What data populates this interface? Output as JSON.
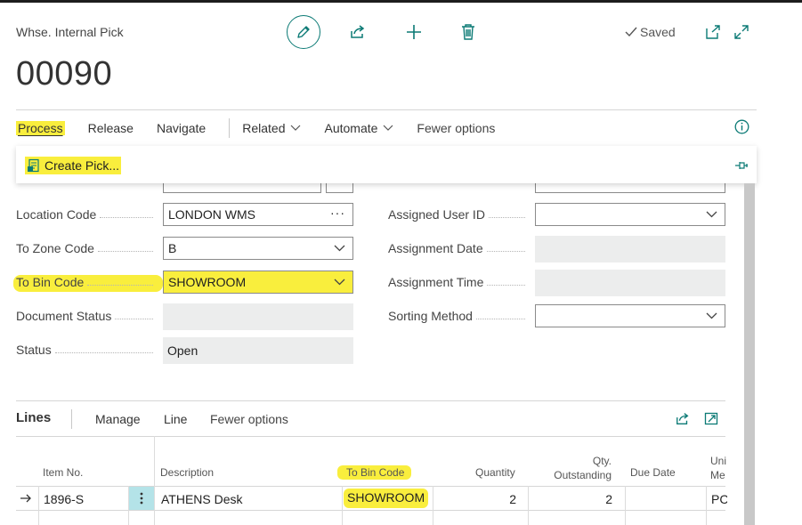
{
  "header": {
    "doc_type": "Whse. Internal Pick",
    "doc_no": "00090",
    "saved_label": "Saved"
  },
  "toolbar": {
    "edit_icon": "pencil-icon",
    "share_icon": "share-icon",
    "new_icon": "plus-icon",
    "delete_icon": "trash-icon",
    "open_new_window_icon": "open-in-new-window-icon",
    "expand_icon": "expand-icon"
  },
  "actionbar": {
    "process": "Process",
    "release": "Release",
    "navigate": "Navigate",
    "related": "Related",
    "automate": "Automate",
    "fewer_options": "Fewer options"
  },
  "process_menu": {
    "create_pick": "Create Pick..."
  },
  "general": {
    "left": [
      {
        "label": "Location Code",
        "value": "LONDON WMS"
      },
      {
        "label": "To Zone Code",
        "value": "B"
      },
      {
        "label": "To Bin Code",
        "value": "SHOWROOM"
      },
      {
        "label": "Document Status",
        "value": ""
      },
      {
        "label": "Status",
        "value": "Open"
      }
    ],
    "right": [
      {
        "label": "Assigned User ID",
        "value": ""
      },
      {
        "label": "Assignment Date",
        "value": ""
      },
      {
        "label": "Assignment Time",
        "value": ""
      },
      {
        "label": "Sorting Method",
        "value": ""
      }
    ]
  },
  "lines": {
    "title": "Lines",
    "manage": "Manage",
    "line": "Line",
    "fewer_options": "Fewer options",
    "columns": {
      "item_no": "Item No.",
      "description": "Description",
      "to_bin_code": "To Bin Code",
      "quantity": "Quantity",
      "qty_outstanding_1": "Qty.",
      "qty_outstanding_2": "Outstanding",
      "due_date": "Due Date",
      "unit_1": "Uni",
      "unit_2": "Me"
    },
    "rows": [
      {
        "item_no": "1896-S",
        "description": "ATHENS Desk",
        "to_bin_code": "SHOWROOM",
        "quantity": "2",
        "qty_outstanding": "2",
        "due_date": "",
        "unit": "PC"
      }
    ]
  },
  "colors": {
    "accent": "#0b7a75",
    "highlight": "#f9ee3d"
  }
}
